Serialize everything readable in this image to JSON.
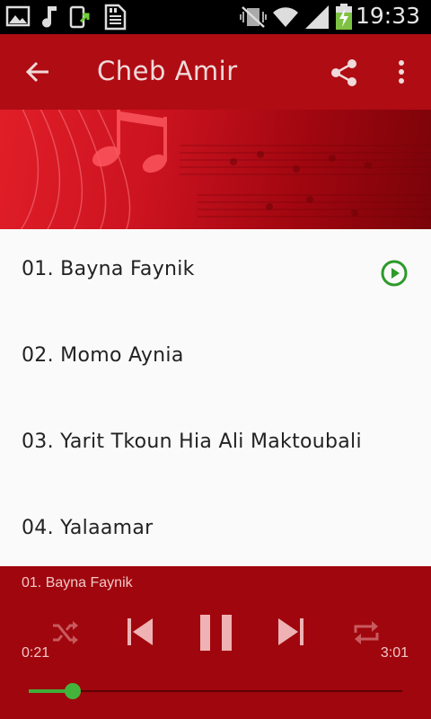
{
  "status_bar": {
    "time": "19:33",
    "left_icons": [
      "gallery-icon",
      "music-note-icon",
      "download-sync-icon",
      "sd-card-icon"
    ],
    "right_icons": [
      "mute-vibrate-icon",
      "wifi-icon",
      "signal-icon",
      "battery-charging-icon"
    ]
  },
  "app_bar": {
    "title": "Cheb Amir",
    "icons": [
      "back-arrow-icon",
      "share-icon",
      "more-vert-icon"
    ],
    "color": "#b00c13"
  },
  "tracks": [
    {
      "label": "01. Bayna Faynik",
      "playing": true
    },
    {
      "label": "02. Momo Aynia",
      "playing": false
    },
    {
      "label": "03. Yarit Tkoun Hia Ali Maktoubali",
      "playing": false
    },
    {
      "label": "04. Yalaamar",
      "playing": false
    }
  ],
  "player": {
    "now_playing": "01. Bayna Faynik",
    "elapsed": "0:21",
    "duration": "3:01",
    "progress": 0.118,
    "controls": [
      "shuffle-icon",
      "previous-icon",
      "pause-icon",
      "next-icon",
      "repeat-icon"
    ],
    "accent": "#43b33c",
    "background": "#a0060d"
  }
}
